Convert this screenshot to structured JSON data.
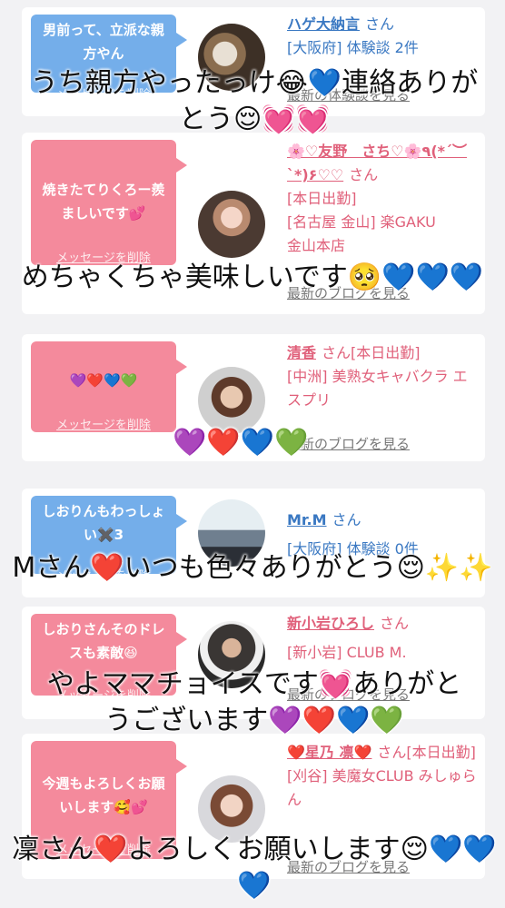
{
  "cards": [
    {
      "bubble": "男前って、立派な親方やん",
      "delete_label": "メッセージを削除",
      "name": "ハゲ大納言",
      "honorific": "さん",
      "lines": [
        "[大阪府] 体験談 2件"
      ],
      "blog_link": "最新の体験談を見る"
    },
    {
      "bubble": "焼きたてりくろー羨ましいです💕",
      "delete_label": "メッセージを削除",
      "name": "🌸♡友野　さち♡🌸٩(*´︶`*)۶♡♡",
      "honorific": "さん",
      "lines": [
        "[本日出勤]",
        "[名古屋 金山] 楽GAKU",
        "金山本店"
      ],
      "blog_link": "最新のブログを見る"
    },
    {
      "bubble": "💜❤️💙💚",
      "delete_label": "メッセージを削除",
      "name": "清香",
      "honorific": "さん[本日出勤]",
      "lines": [
        "[中洲] 美熟女キャバクラ エスプリ"
      ],
      "blog_link": "最新のブログを見る"
    },
    {
      "bubble": "しおりんもわっしょい✖️3",
      "delete_label": "メッセージを削除",
      "name": "Mr.M",
      "honorific": "さん",
      "lines": [
        "[大阪府] 体験談 0件"
      ],
      "blog_link": ""
    },
    {
      "bubble": "しおりさんそのドレスも素敵😆",
      "delete_label": "メッセージを削除",
      "name": "新小岩ひろし",
      "honorific": "さん",
      "lines": [
        "[新小岩] CLUB M."
      ],
      "blog_link": "最新のブログを見る"
    },
    {
      "bubble": "今週もよろしくお願いします🥰💕",
      "delete_label": "メッセージを削除",
      "name": "❤️星乃 凛❤️",
      "honorific": "さん[本日出勤]",
      "lines": [
        "[刈谷] 美魔女CLUB みしゅらん"
      ],
      "blog_link": "最新のブログを見る"
    }
  ],
  "overlays": [
    "うち親方やったっけ😂💙連絡ありがとう😌💓💓",
    "めちゃくちゃ美味しいです🥺💙💙💙",
    "💜❤️💙💚",
    "Mさん❤️いつも色々ありがとう😌✨✨",
    "やよママチョイスです💓ありがとうございます💜❤️💙💚",
    "凜さん❤️よろしくお願いします😌💙💙💙"
  ],
  "colors": {
    "male_bubble": "#74aeea",
    "female_bubble": "#f48a9c",
    "male_text": "#3a78c2",
    "female_text": "#e0607a"
  }
}
